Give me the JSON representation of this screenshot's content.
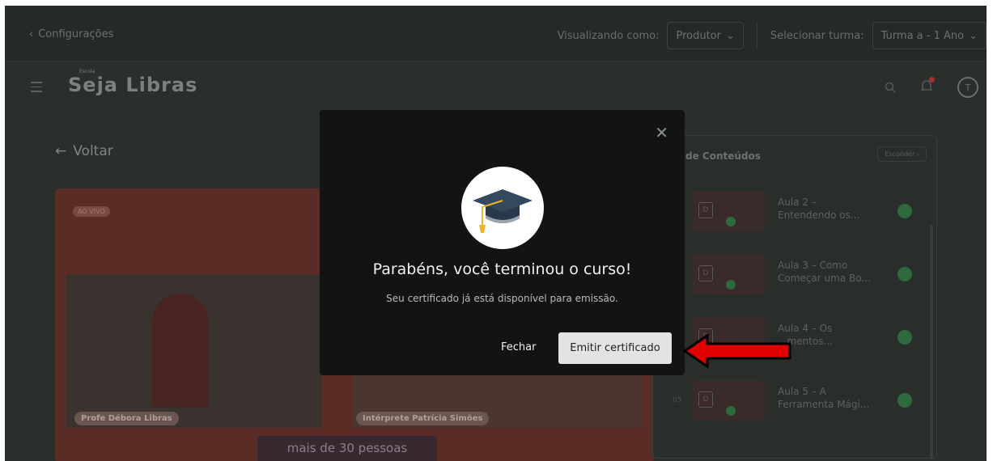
{
  "topbar": {
    "back_label": "Configurações",
    "viewing_as_label": "Visualizando como:",
    "viewing_as_value": "Produtor",
    "select_class_label": "Selecionar turma:",
    "select_class_value": "Turma a - 1 Ano"
  },
  "header": {
    "logo_text": "Seja Libras",
    "logo_small": "Escola",
    "avatar_initial": "T"
  },
  "page": {
    "back_label": "Voltar"
  },
  "video": {
    "live_badge": "AO VIVO",
    "presenter_tag": "Profe Débora Libras",
    "interpreter_tag": "Intérprete Patrícia Simões",
    "caption": "mais de 30 pessoas"
  },
  "sidebar": {
    "title": "de Conteúdos",
    "hide_label": "Esconder",
    "lessons": [
      {
        "num": "",
        "title": "Aula 2 – Entendendo os..."
      },
      {
        "num": "",
        "title": "Aula 3 – Como Começar uma Bo..."
      },
      {
        "num": "",
        "title": "Aula 4 – Os ...mentos..."
      },
      {
        "num": "05",
        "title": "Aula 5 – A Ferramenta Mági..."
      }
    ]
  },
  "modal": {
    "title": "Parabéns, você terminou o curso!",
    "subtitle": "Seu certificado já está disponível para emissão.",
    "close_label": "Fechar",
    "emit_label": "Emitir certificado"
  },
  "colors": {
    "overlay": "#2b2f2c",
    "modal_bg": "#121413",
    "emit_button": "#e2e4e2",
    "annotation_arrow": "#e00000"
  }
}
